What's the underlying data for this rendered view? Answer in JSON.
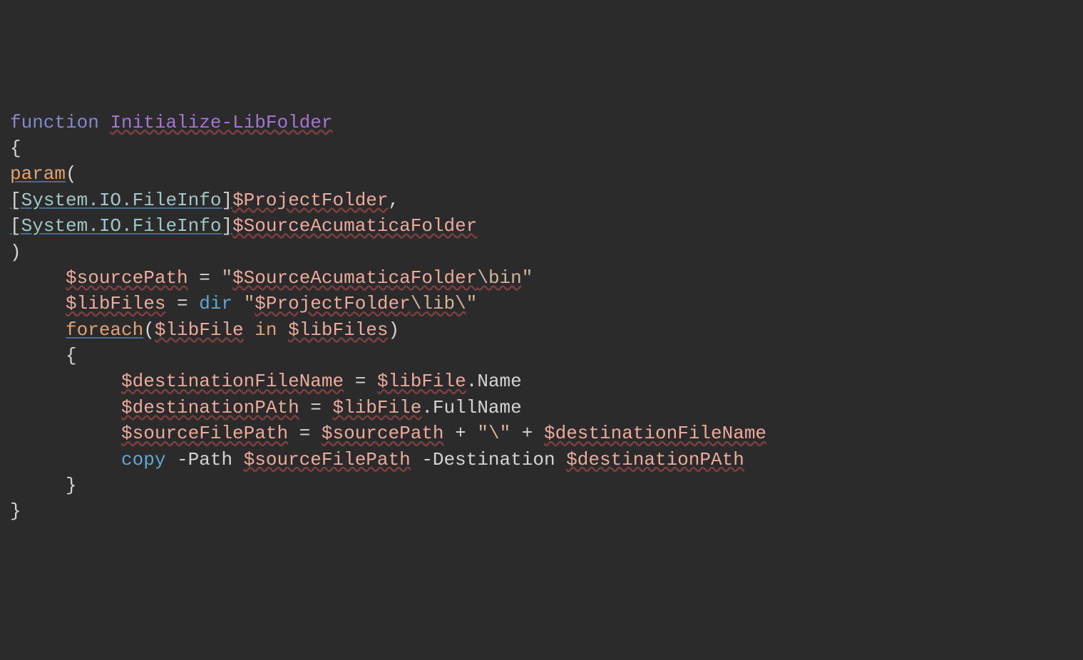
{
  "code": {
    "t_function": "function",
    "t_funcname": "Initialize-LibFolder",
    "t_obrace": "{",
    "t_cbrace": "}",
    "t_param": "param",
    "t_oparen": "(",
    "t_cparen": ")",
    "t_obracket": "[",
    "t_cbracket": "]",
    "t_type": "System.IO.FileInfo",
    "t_ProjectFolder": "$ProjectFolder",
    "t_SourceAcumaticaFolder": "$SourceAcumaticaFolder",
    "t_comma": ",",
    "t_sourcePath": "$sourcePath",
    "t_eq": " = ",
    "t_q": "\"",
    "t_binstr": "\\bin",
    "t_libFiles": "$libFiles",
    "t_dir": "dir",
    "t_libstr": "\\lib\\",
    "t_foreach": "foreach",
    "t_libFile": "$libFile",
    "t_in": " in ",
    "t_destinationFileName": "$destinationFileName",
    "t_dot": ".",
    "t_Name": "Name",
    "t_destinationPAth": "$destinationPAth",
    "t_FullName": "FullName",
    "t_sourceFilePath": "$sourceFilePath",
    "t_plus": " + ",
    "t_bslash": "\\",
    "t_copy": "copy",
    "t_PathFlag": " -Path ",
    "t_DestFlag": " -Destination ",
    "indent1": "     ",
    "indent2": "          "
  },
  "colors": {
    "background": "#2b2b2b",
    "keyword": "#8588cf",
    "function_name": "#a575d4",
    "type": "#a0c7c7",
    "variable": "#ecab9c",
    "string": "#d4b69a",
    "command": "#5fa7d4",
    "param_keyword": "#e0a374",
    "default": "#d4d4d4"
  }
}
